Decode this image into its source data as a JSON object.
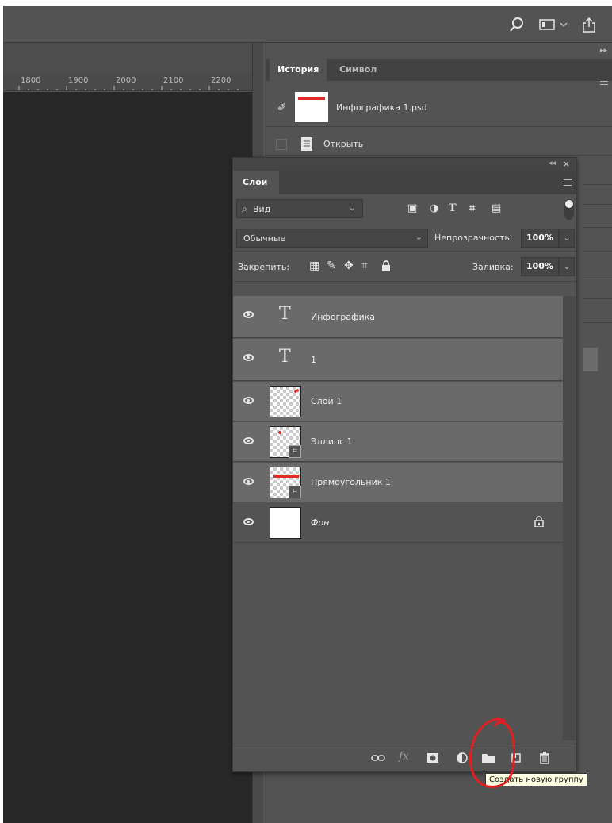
{
  "ruler": {
    "ticks": [
      "1800",
      "1900",
      "2000",
      "2100",
      "2200"
    ]
  },
  "history_panel": {
    "tabs": [
      "История",
      "Символ"
    ],
    "snapshot_label": "Инфографика 1.psd",
    "open_label": "Открыть"
  },
  "layers_panel": {
    "tab": "Слои",
    "filter_label": "Вид",
    "blend_mode": "Обычные",
    "opacity_label": "Непрозрачность:",
    "opacity_value": "100%",
    "lock_label": "Закрепить:",
    "fill_label": "Заливка:",
    "fill_value": "100%",
    "layers": [
      {
        "name": "Инфографика",
        "kind": "text",
        "glyph": "T"
      },
      {
        "name": "1",
        "kind": "text",
        "glyph": "T"
      },
      {
        "name": "Слой 1",
        "kind": "raster"
      },
      {
        "name": "Эллипс 1",
        "kind": "shape"
      },
      {
        "name": "Прямоугольник 1",
        "kind": "shape"
      },
      {
        "name": "Фон",
        "kind": "background",
        "locked": true
      }
    ],
    "footer_icons": [
      "link-icon",
      "fx-icon",
      "mask-icon",
      "adjustment-icon",
      "new-group-icon",
      "new-layer-icon",
      "trash-icon"
    ]
  },
  "tooltip": {
    "text": "Создать новую группу"
  },
  "colors": {
    "panel": "#535353",
    "canvas": "#282828",
    "annotation": "#e02020",
    "thumb_accent": "#e02a2a"
  }
}
